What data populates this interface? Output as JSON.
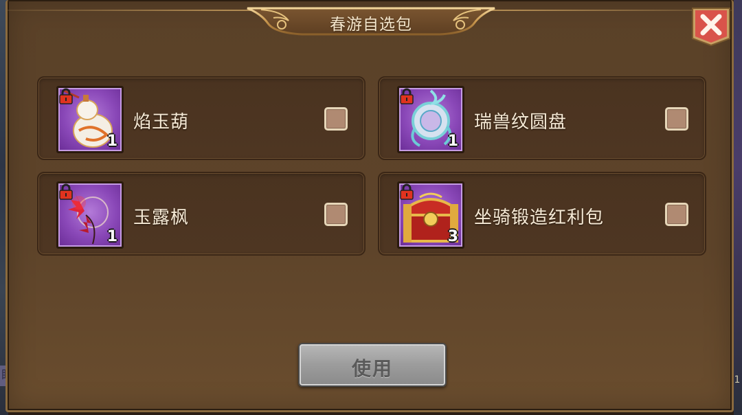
{
  "dialog": {
    "title": "春游自选包"
  },
  "items": [
    {
      "name": "焰玉葫",
      "quantity": "1",
      "icon": "gourd-icon",
      "locked": true,
      "checked": false
    },
    {
      "name": "瑞兽纹圆盘",
      "quantity": "1",
      "icon": "disc-icon",
      "locked": true,
      "checked": false
    },
    {
      "name": "玉露枫",
      "quantity": "1",
      "icon": "maple-icon",
      "locked": true,
      "checked": false
    },
    {
      "name": "坐骑锻造红利包",
      "quantity": "3",
      "icon": "treasure-chest-icon",
      "locked": true,
      "checked": false
    }
  ],
  "actions": {
    "use_label": "使用"
  },
  "background": {
    "left_fragment": "眼",
    "right_fragment": "1"
  },
  "colors": {
    "panel": "#5a4128",
    "card": "#4a3320",
    "icon_bg": "#8a48b8",
    "close_button": "#d9534a",
    "use_button": "#9c9c9c"
  }
}
